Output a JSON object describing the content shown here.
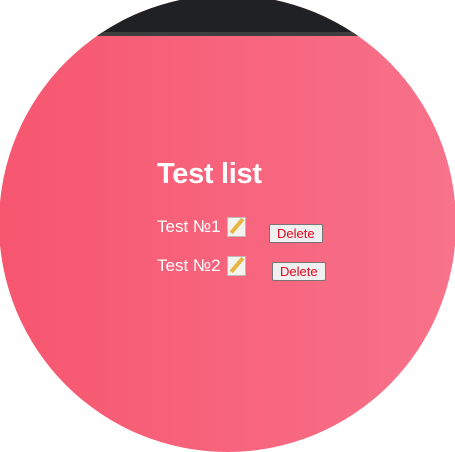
{
  "title": "Test list",
  "items": [
    {
      "label": "Test №1",
      "icon": "memo-icon",
      "delete_label": "Delete"
    },
    {
      "label": "Test №2",
      "icon": "memo-icon",
      "delete_label": "Delete"
    }
  ]
}
